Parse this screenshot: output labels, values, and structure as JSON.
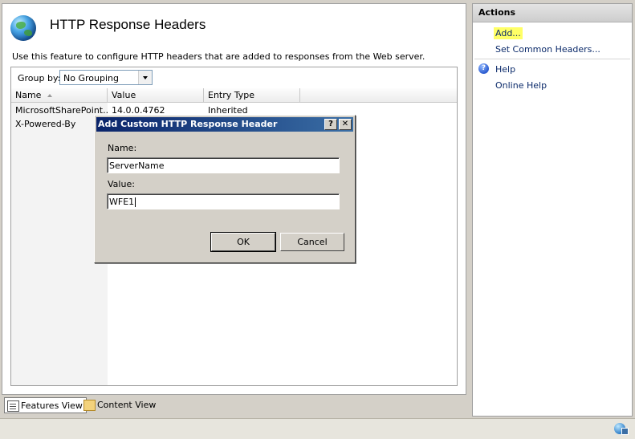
{
  "header": {
    "title": "HTTP Response Headers",
    "description": "Use this feature to configure HTTP headers that are added to responses from the Web server."
  },
  "toolbar": {
    "group_by_label": "Group by:",
    "group_by_value": "No Grouping"
  },
  "grid": {
    "columns": [
      "Name",
      "Value",
      "Entry Type"
    ],
    "rows": [
      {
        "name": "MicrosoftSharePoint...",
        "value": "14.0.0.4762",
        "entry_type": "Inherited"
      },
      {
        "name": "X-Powered-By",
        "value": "",
        "entry_type": ""
      }
    ]
  },
  "dialog": {
    "title": "Add Custom HTTP Response Header",
    "help_label": "?",
    "close_label": "✕",
    "name_label": "Name:",
    "name_value": "ServerName",
    "value_label": "Value:",
    "value_value": "WFE1",
    "ok_label": "OK",
    "cancel_label": "Cancel"
  },
  "bottom_tabs": [
    {
      "label": "Features View",
      "active": true
    },
    {
      "label": "Content View",
      "active": false
    }
  ],
  "actions": {
    "title": "Actions",
    "add": "Add...",
    "set_common": "Set Common Headers...",
    "help": "Help",
    "online_help": "Online Help"
  },
  "colors": {
    "dialog_title_start": "#0a246a",
    "dialog_title_end": "#3a6ea5",
    "link": "#0b2a6a",
    "highlight": "#ffff66"
  }
}
